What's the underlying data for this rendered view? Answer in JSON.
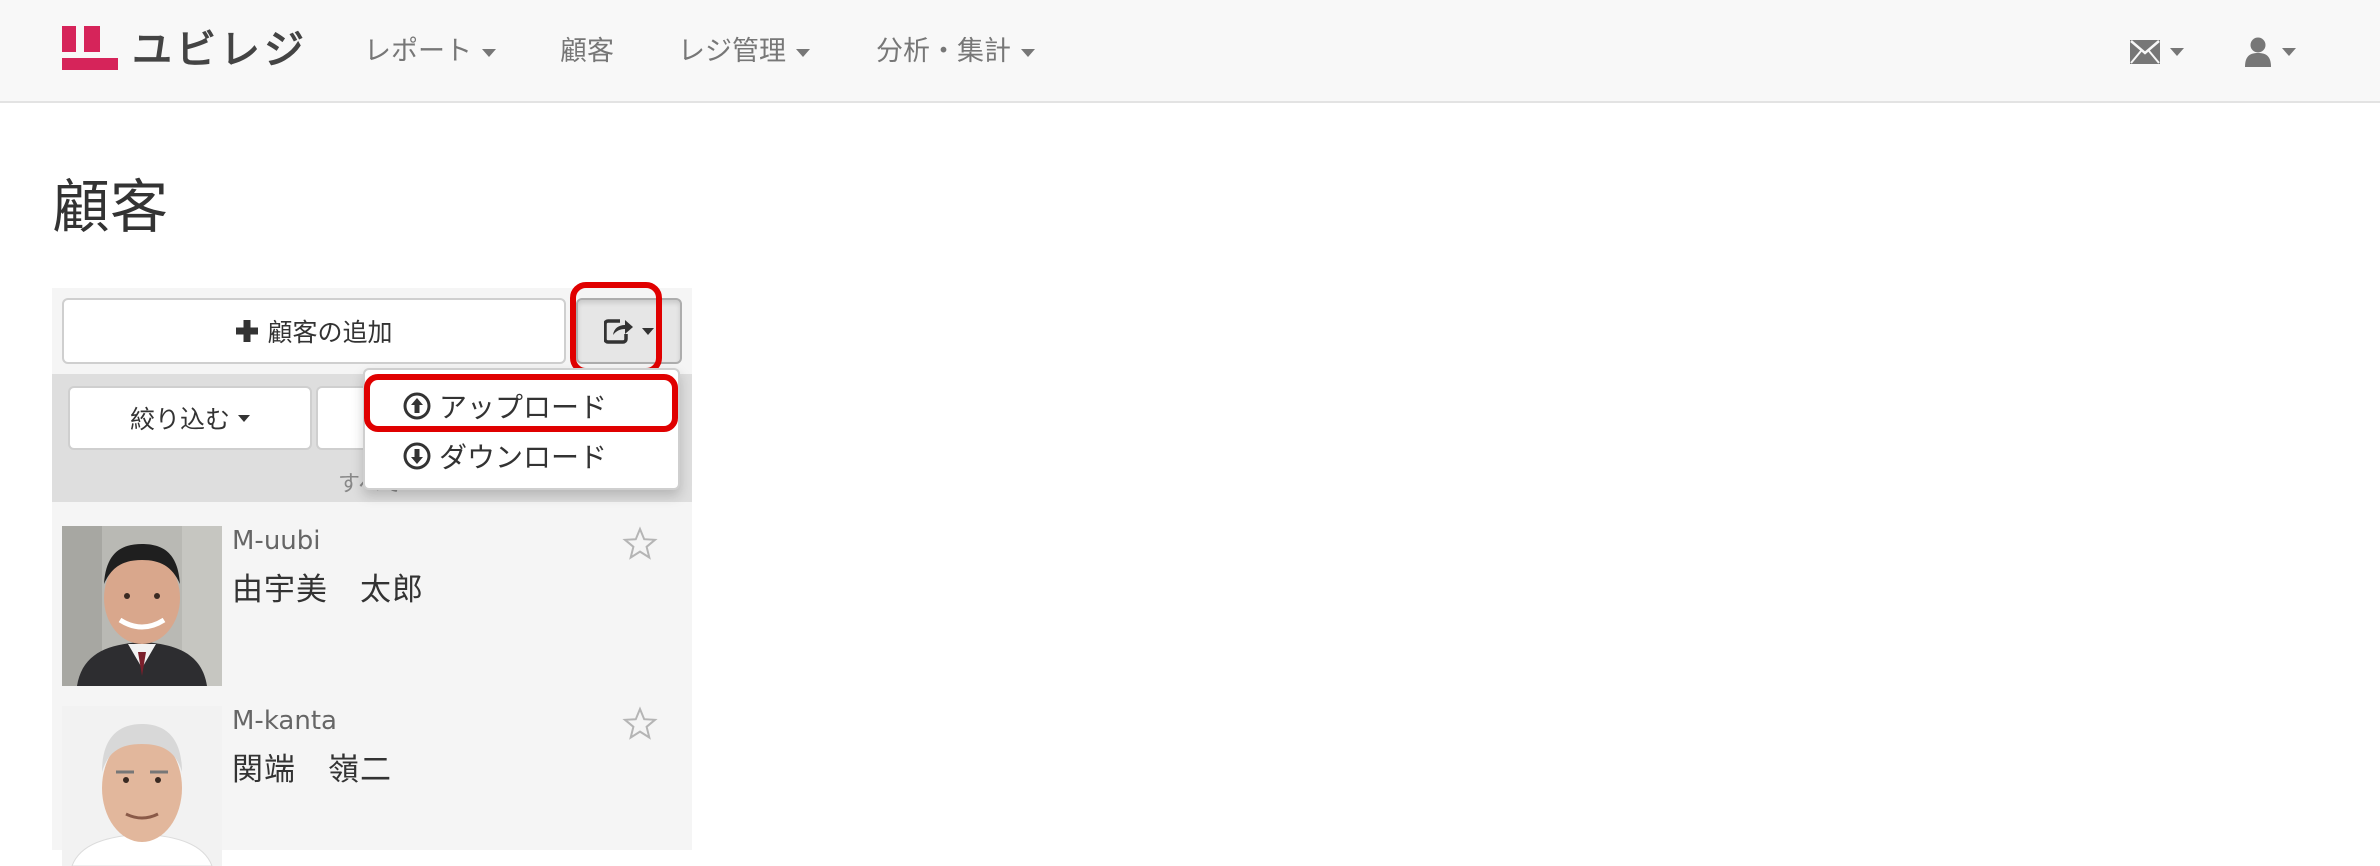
{
  "navbar": {
    "logo_text": "ユビレジ",
    "items": [
      {
        "label": "レポート",
        "dropdown": true
      },
      {
        "label": "顧客",
        "dropdown": false
      },
      {
        "label": "レジ管理",
        "dropdown": true
      },
      {
        "label": "分析・集計",
        "dropdown": true
      }
    ],
    "icons": [
      "envelope-icon",
      "user-icon"
    ]
  },
  "page": {
    "title": "顧客"
  },
  "toolbar": {
    "add_label": "顧客の追加",
    "export_icon": "share-icon"
  },
  "filter": {
    "label": "絞り込む",
    "hint": "すべて"
  },
  "dropdown": {
    "items": [
      {
        "label": "アップロード",
        "icon": "upload-circle-icon"
      },
      {
        "label": "ダウンロード",
        "icon": "download-circle-icon"
      }
    ]
  },
  "customers": [
    {
      "id": "M-uubi",
      "name": "由宇美　太郎"
    },
    {
      "id": "M-kanta",
      "name": "関端　嶺二"
    }
  ],
  "colors": {
    "brand": "#d6245a",
    "highlight": "#e00000"
  }
}
